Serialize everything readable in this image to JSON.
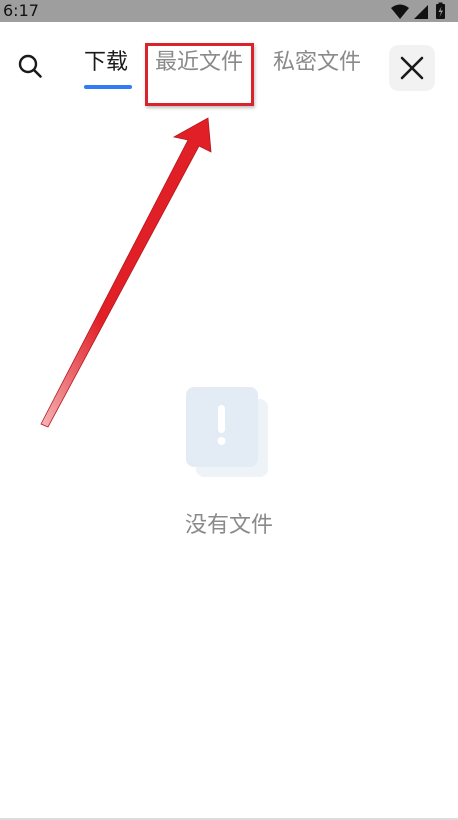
{
  "status_bar": {
    "time": "6:17",
    "icons": [
      "wifi-icon",
      "signal-icon",
      "battery-charging-icon"
    ]
  },
  "header": {
    "search_icon": "search-icon",
    "close_icon": "close-icon",
    "tabs": [
      {
        "label": "下载",
        "active": true
      },
      {
        "label": "最近文件",
        "active": false
      },
      {
        "label": "私密文件",
        "active": false
      }
    ]
  },
  "annotation": {
    "highlight_color": "#d9232d",
    "arrow_color": "#e0161e",
    "target": "tab-recent-files"
  },
  "empty_state": {
    "icon": "empty-file-alert-icon",
    "message": "没有文件"
  },
  "colors": {
    "accent": "#2f7cf6",
    "status_bar_bg": "#9e9e9e",
    "inactive_text": "#8a8a8a",
    "active_text": "#1a1a1a"
  }
}
